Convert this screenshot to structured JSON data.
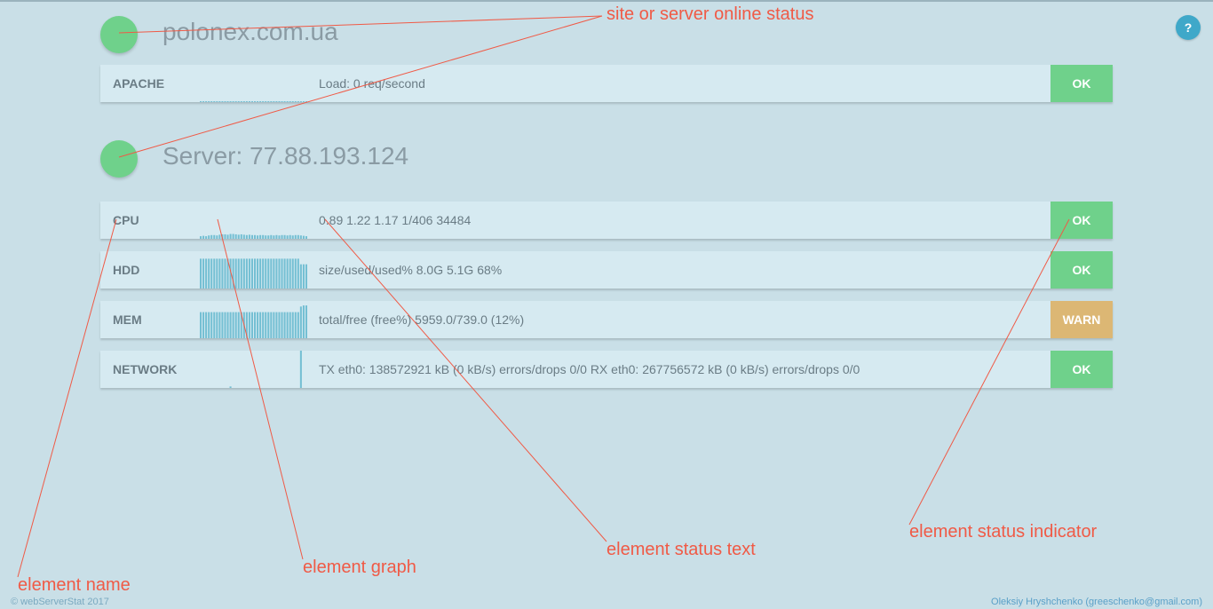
{
  "site": {
    "title": "polonex.com.ua",
    "online": true
  },
  "server": {
    "title": "Server: 77.88.193.124",
    "online": true
  },
  "help": {
    "label": "?"
  },
  "colors": {
    "ok": "#6fd18b",
    "warn": "#dcb774",
    "graph": "#74bfd3",
    "annotation": "#f05a46"
  },
  "site_rows": [
    {
      "name": "APACHE",
      "text": "Load: 0 req/second",
      "status": "OK",
      "graph": [
        0.02,
        0.02,
        0.02,
        0.02,
        0.02,
        0.02,
        0.02,
        0.02,
        0.02,
        0.02,
        0.02,
        0.02,
        0.02,
        0.02,
        0.02,
        0.02,
        0.02,
        0.02,
        0.02,
        0.02,
        0.02,
        0.02,
        0.02,
        0.02,
        0.02,
        0.02,
        0.02,
        0.02,
        0.02,
        0.02,
        0.02,
        0.02,
        0.02,
        0.02,
        0.02,
        0.02,
        0.02,
        0.02,
        0.02,
        0.02
      ]
    }
  ],
  "server_rows": [
    {
      "name": "CPU",
      "text": "0.89 1.22 1.17 1/406 34484",
      "status": "OK",
      "graph": [
        0.07,
        0.08,
        0.07,
        0.09,
        0.1,
        0.1,
        0.09,
        0.11,
        0.12,
        0.12,
        0.11,
        0.13,
        0.13,
        0.12,
        0.11,
        0.12,
        0.11,
        0.1,
        0.11,
        0.1,
        0.1,
        0.09,
        0.1,
        0.1,
        0.09,
        0.09,
        0.1,
        0.09,
        0.1,
        0.09,
        0.1,
        0.1,
        0.09,
        0.1,
        0.09,
        0.1,
        0.1,
        0.09,
        0.08,
        0.07
      ]
    },
    {
      "name": "HDD",
      "text": "size/used/used% 8.0G 5.1G 68%",
      "status": "OK",
      "graph": [
        0.8,
        0.8,
        0.8,
        0.8,
        0.8,
        0.8,
        0.8,
        0.8,
        0.8,
        0.8,
        0.8,
        0.8,
        0.8,
        0.8,
        0.8,
        0.8,
        0.8,
        0.8,
        0.8,
        0.8,
        0.8,
        0.8,
        0.8,
        0.8,
        0.8,
        0.8,
        0.8,
        0.8,
        0.8,
        0.8,
        0.8,
        0.8,
        0.8,
        0.8,
        0.8,
        0.8,
        0.8,
        0.65,
        0.65,
        0.65
      ]
    },
    {
      "name": "MEM",
      "text": "total/free (free%) 5959.0/739.0 (12%)",
      "status": "WARN",
      "graph": [
        0.7,
        0.7,
        0.7,
        0.7,
        0.7,
        0.7,
        0.7,
        0.7,
        0.7,
        0.7,
        0.7,
        0.7,
        0.7,
        0.7,
        0.7,
        0.7,
        0.7,
        0.7,
        0.7,
        0.7,
        0.7,
        0.7,
        0.7,
        0.7,
        0.7,
        0.7,
        0.7,
        0.7,
        0.7,
        0.7,
        0.7,
        0.7,
        0.7,
        0.7,
        0.7,
        0.7,
        0.7,
        0.85,
        0.88,
        0.88
      ]
    },
    {
      "name": "NETWORK",
      "text": "TX eth0: 138572921 kB (0 kB/s) errors/drops 0/0 RX eth0: 267756572 kB (0 kB/s) errors/drops 0/0",
      "status": "OK",
      "graph": [
        0,
        0,
        0,
        0,
        0,
        0,
        0,
        0,
        0,
        0,
        0,
        0.04,
        0,
        0,
        0,
        0,
        0,
        0,
        0,
        0,
        0,
        0,
        0,
        0,
        0,
        0,
        0,
        0,
        0,
        0,
        0,
        0,
        0,
        0,
        0,
        0,
        0,
        1,
        0,
        0
      ]
    }
  ],
  "annotations": [
    "site or server online status",
    "element status indicator",
    "element status text",
    "element graph",
    "element name"
  ],
  "footer": {
    "left": "© webServerStat 2017",
    "right": "Oleksiy Hryshchenko (greeschenko@gmail.com)"
  }
}
